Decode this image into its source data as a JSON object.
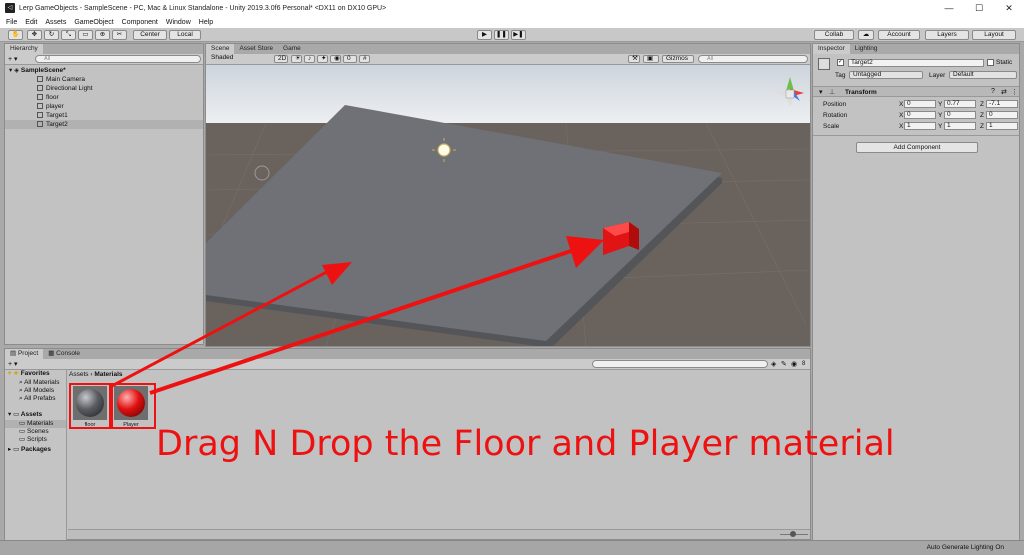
{
  "window": {
    "title": "Lerp GameObjects - SampleScene - PC, Mac & Linux Standalone - Unity 2019.3.0f6 Personal* <DX11 on DX10 GPU>",
    "minimize": "—",
    "maximize": "☐",
    "close": "✕"
  },
  "menu": [
    "File",
    "Edit",
    "Assets",
    "GameObject",
    "Component",
    "Window",
    "Help"
  ],
  "toolbar": {
    "center": "Center",
    "local": "Local",
    "collab": "Collab",
    "account": "Account",
    "layers": "Layers",
    "layout": "Layout"
  },
  "hierarchy": {
    "tab": "Hierarchy",
    "add": "+ ▾",
    "search_placeholder": "All",
    "scene": "SampleScene*",
    "items": [
      "Main Camera",
      "Directional Light",
      "floor",
      "player",
      "Target1",
      "Target2"
    ]
  },
  "scene": {
    "tabs": [
      "Scene",
      "Asset Store",
      "Game"
    ],
    "shading": "Shaded",
    "mode2d": "2D",
    "gizmos": "Gizmos",
    "search_placeholder": "All",
    "fx_count": "0"
  },
  "inspector": {
    "tabs": [
      "Inspector",
      "Lighting"
    ],
    "object_name": "Target2",
    "static_label": "Static",
    "tag_label": "Tag",
    "tag_value": "Untagged",
    "layer_label": "Layer",
    "layer_value": "Default",
    "transform_title": "Transform",
    "rows": [
      {
        "label": "Position",
        "x": "0",
        "y": "0.77",
        "z": "-7.1"
      },
      {
        "label": "Rotation",
        "x": "0",
        "y": "0",
        "z": "0"
      },
      {
        "label": "Scale",
        "x": "1",
        "y": "1",
        "z": "1"
      }
    ],
    "axis_x": "X",
    "axis_y": "Y",
    "axis_z": "Z",
    "add_component": "Add Component"
  },
  "project": {
    "tabs": [
      "Project",
      "Console"
    ],
    "add": "+ ▾",
    "favorites": "Favorites",
    "favorite_items": [
      "All Materials",
      "All Models",
      "All Prefabs"
    ],
    "assets": "Assets",
    "asset_items": [
      "Materials",
      "Scenes",
      "Scripts"
    ],
    "packages": "Packages",
    "breadcrumb_root": "Assets",
    "breadcrumb_sep": "›",
    "breadcrumb_current": "Materials",
    "materials": [
      {
        "name": "floor",
        "color": "#5a5c62"
      },
      {
        "name": "Player",
        "color": "#e01010"
      }
    ],
    "hidden_count": "8"
  },
  "annotation": {
    "text": "Drag N Drop the Floor and Player material",
    "color": "#ee1111"
  },
  "status": {
    "text": "Auto Generate Lighting On"
  }
}
